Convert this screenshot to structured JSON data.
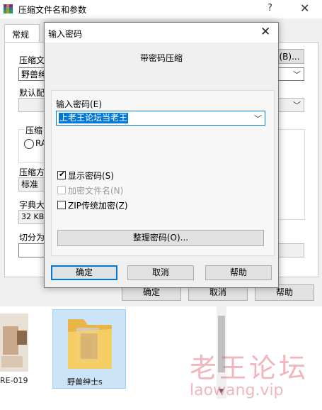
{
  "background_dialog": {
    "title": "压缩文件名和参数",
    "help_glyph": "?",
    "close_glyph": "✕",
    "tab_general": "常规",
    "archive_name_label": "压缩文",
    "browse_button": "(B)...",
    "archive_name_value": "野兽绅",
    "default_profile_label": "默认配",
    "archive_format_label": "压缩",
    "rar_radio": "RA",
    "method_label": "压缩方",
    "method_value": "标准",
    "dict_label": "字典大",
    "dict_value": "32 KB",
    "split_label": "切分为",
    "ok": "确定",
    "cancel": "取消",
    "help": "帮助"
  },
  "desktop": {
    "file1_label": "RE-019",
    "folder_label": "野兽绅士s",
    "watermark_cn": "老王论坛",
    "watermark_url": "laowang.vip"
  },
  "password_dialog": {
    "title": "输入密码",
    "close_glyph": "✕",
    "heading": "带密码压缩",
    "input_label": "输入密码(E)",
    "input_value": "上老王论坛当老王",
    "checkboxes": [
      {
        "label": "显示密码(S)",
        "checked": true,
        "enabled": true
      },
      {
        "label": "加密文件名(N)",
        "checked": false,
        "enabled": false
      },
      {
        "label": "ZIP传统加密(Z)",
        "checked": false,
        "enabled": true
      }
    ],
    "organize_button": "整理密码(O)...",
    "ok": "确定",
    "cancel": "取消",
    "help": "帮助"
  },
  "colors": {
    "accent": "#0078d7",
    "watermark": "#dd515c"
  }
}
